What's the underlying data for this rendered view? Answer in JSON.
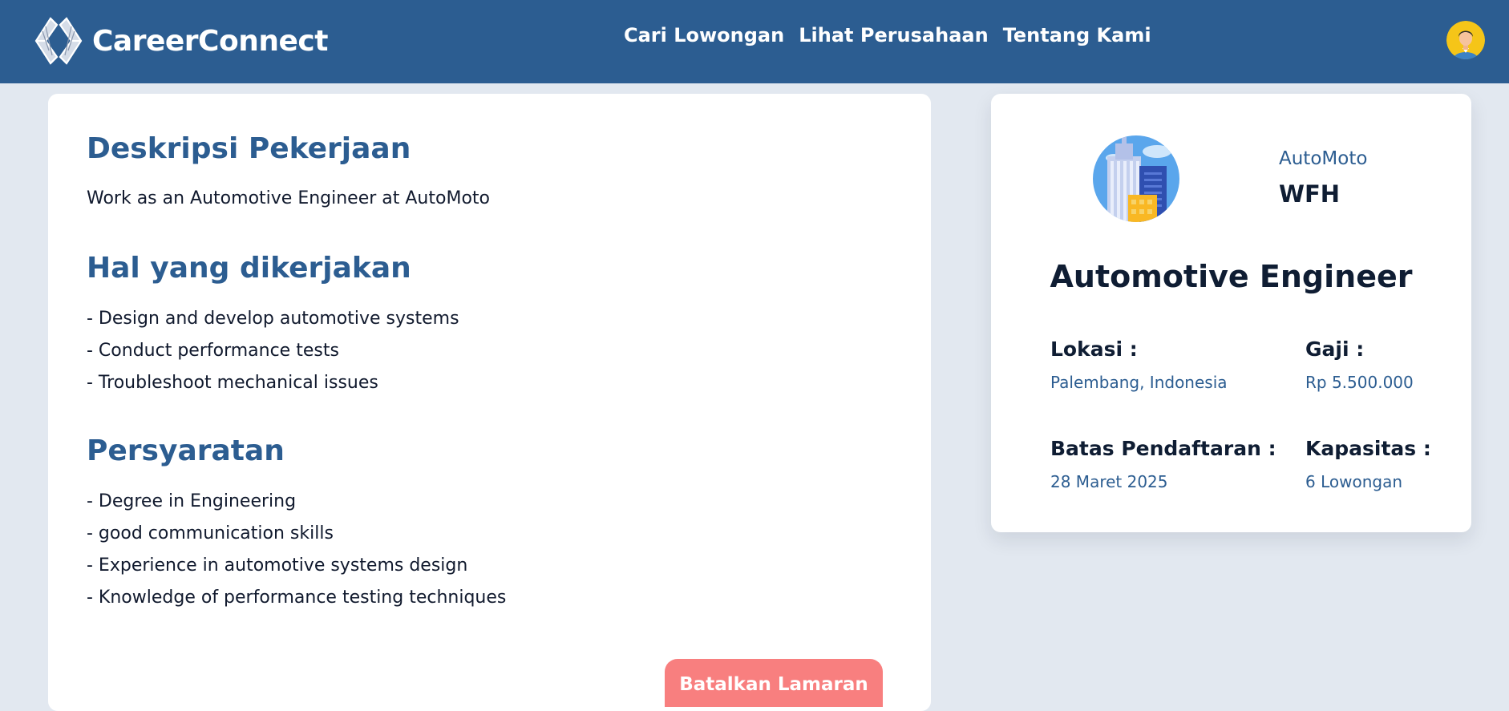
{
  "header": {
    "brand_name": "CareerConnect",
    "nav": [
      "Cari Lowongan",
      "Lihat Perusahaan",
      "Tentang Kami"
    ],
    "brand_color": "#2c5d91"
  },
  "job_description": {
    "heading": "Deskripsi Pekerjaan",
    "text": "Work as an Automotive Engineer at AutoMoto"
  },
  "responsibilities": {
    "heading": "Hal yang dikerjakan",
    "items": [
      "- Design and develop automotive systems",
      "- Conduct performance tests",
      "- Troubleshoot mechanical issues"
    ]
  },
  "requirements": {
    "heading": "Persyaratan",
    "items": [
      "- Degree in Engineering",
      "- good communication skills",
      "- Experience in automotive systems design",
      "- Knowledge of performance testing techniques"
    ]
  },
  "actions": {
    "cancel_label": "Batalkan Lamaran",
    "cancel_color": "#f87f7f"
  },
  "summary": {
    "company": "AutoMoto",
    "work_type": "WFH",
    "job_title": "Automotive Engineer",
    "location_label": "Lokasi :",
    "location": "Palembang, Indonesia",
    "salary_label": "Gaji :",
    "salary": "Rp 5.500.000",
    "deadline_label": "Batas Pendaftaran :",
    "deadline": "28 Maret 2025",
    "capacity_label": "Kapasitas :",
    "capacity": "6 Lowongan"
  },
  "icons": [
    "careerconnect-logo-icon",
    "user-avatar-icon",
    "company-building-icon"
  ]
}
